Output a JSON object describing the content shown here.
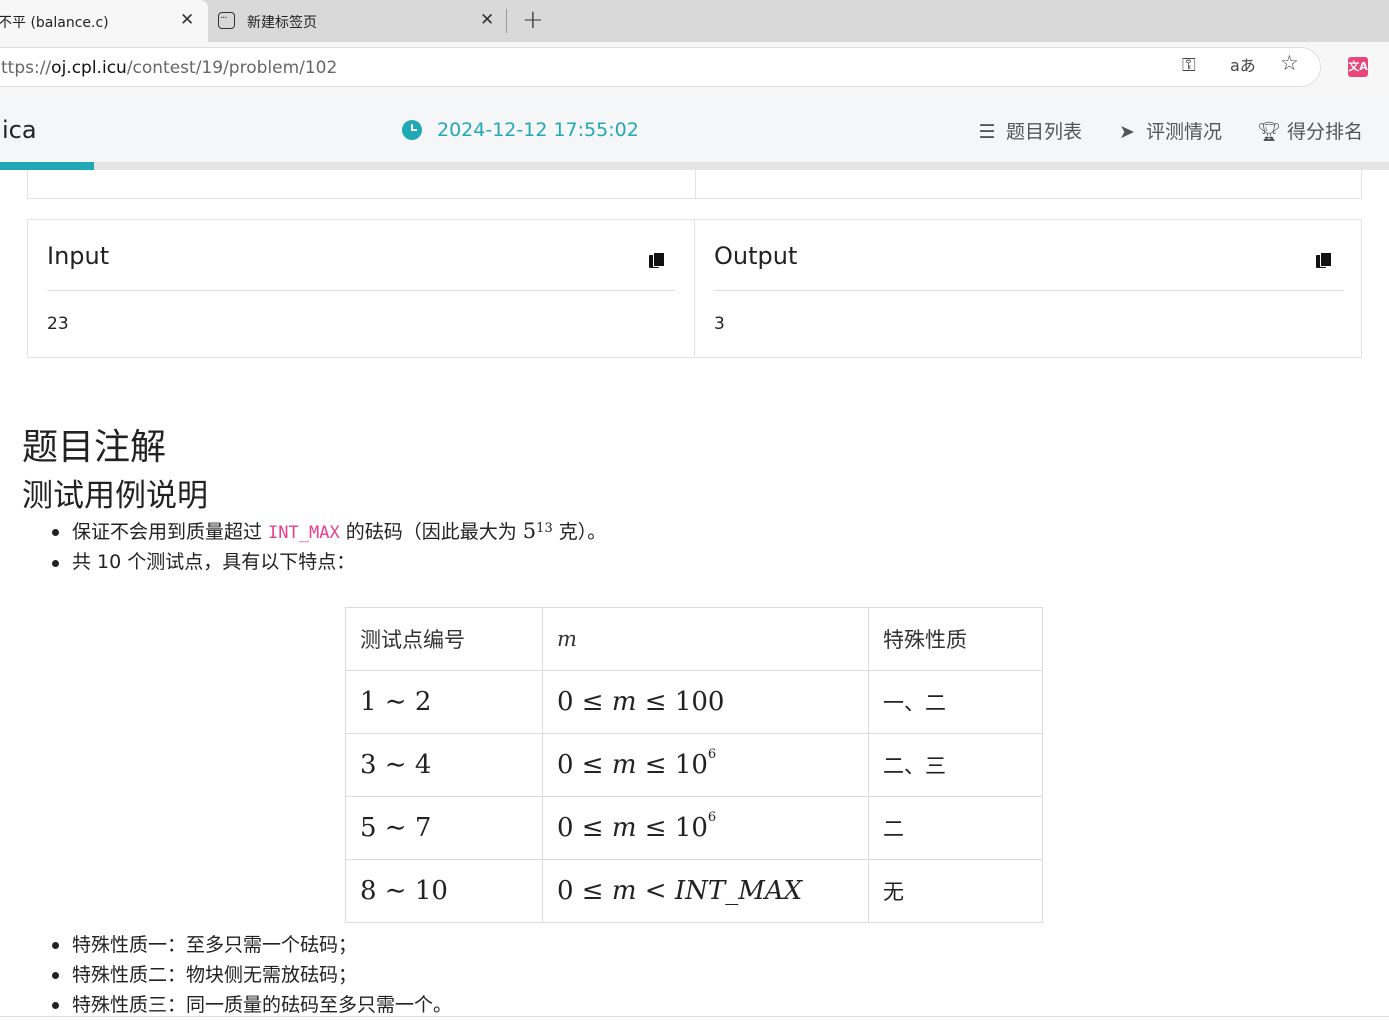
{
  "browser": {
    "tabs": [
      {
        "title": "不平 (balance.c)",
        "active": true
      },
      {
        "title": "新建标签页",
        "active": false
      }
    ],
    "close_glyph": "✕",
    "new_tab_glyph": "+",
    "url_prefix": "ttps://",
    "url_host": "oj.cpl.icu",
    "url_path": "/contest/19/problem/102",
    "translate_glyph": "aあ"
  },
  "header": {
    "brand": "ica",
    "datetime": "2024-12-12 17:55:02",
    "nav": [
      {
        "label": "题目列表",
        "icon": "list-icon"
      },
      {
        "label": "评测情况",
        "icon": "paper-plane-icon"
      },
      {
        "label": "得分排名",
        "icon": "trophy-icon"
      }
    ],
    "progress_fraction": 0.068,
    "accent_color": "#21a8b7"
  },
  "samples": {
    "input": {
      "title": "Input",
      "value": "23"
    },
    "output": {
      "title": "Output",
      "value": "3"
    }
  },
  "notes": {
    "heading": "题目注解",
    "subheading": "测试用例说明",
    "bullet1": {
      "before": "保证不会用到质量超过 ",
      "code": "INT_MAX",
      "middle": " 的砝码（因此最大为 ",
      "math_base": "5",
      "math_exp": "13",
      "after": " 克）。"
    },
    "bullet2": "共 10 个测试点，具有以下特点：",
    "table": {
      "headers": [
        "测试点编号",
        "m",
        "特殊性质"
      ],
      "rows": [
        {
          "range": "1 ∼ 2",
          "m_pre": "0 ≤ ",
          "m_var": "m",
          "m_post": " ≤ 100",
          "m_exp": "",
          "prop": "一、二"
        },
        {
          "range": "3 ∼ 4",
          "m_pre": "0 ≤ ",
          "m_var": "m",
          "m_post": " ≤ 10",
          "m_exp": "6",
          "prop": "二、三"
        },
        {
          "range": "5 ∼ 7",
          "m_pre": "0 ≤ ",
          "m_var": "m",
          "m_post": " ≤ 10",
          "m_exp": "6",
          "prop": "二"
        },
        {
          "range": "8 ∼ 10",
          "m_pre": "0 ≤ ",
          "m_var": "m",
          "m_post": " < INT_MAX",
          "m_exp": "",
          "prop": "无"
        }
      ]
    },
    "properties": [
      "特殊性质一：至多只需一个砝码；",
      "特殊性质二：物块侧无需放砝码；",
      "特殊性质三：同一质量的砝码至多只需一个。"
    ]
  }
}
